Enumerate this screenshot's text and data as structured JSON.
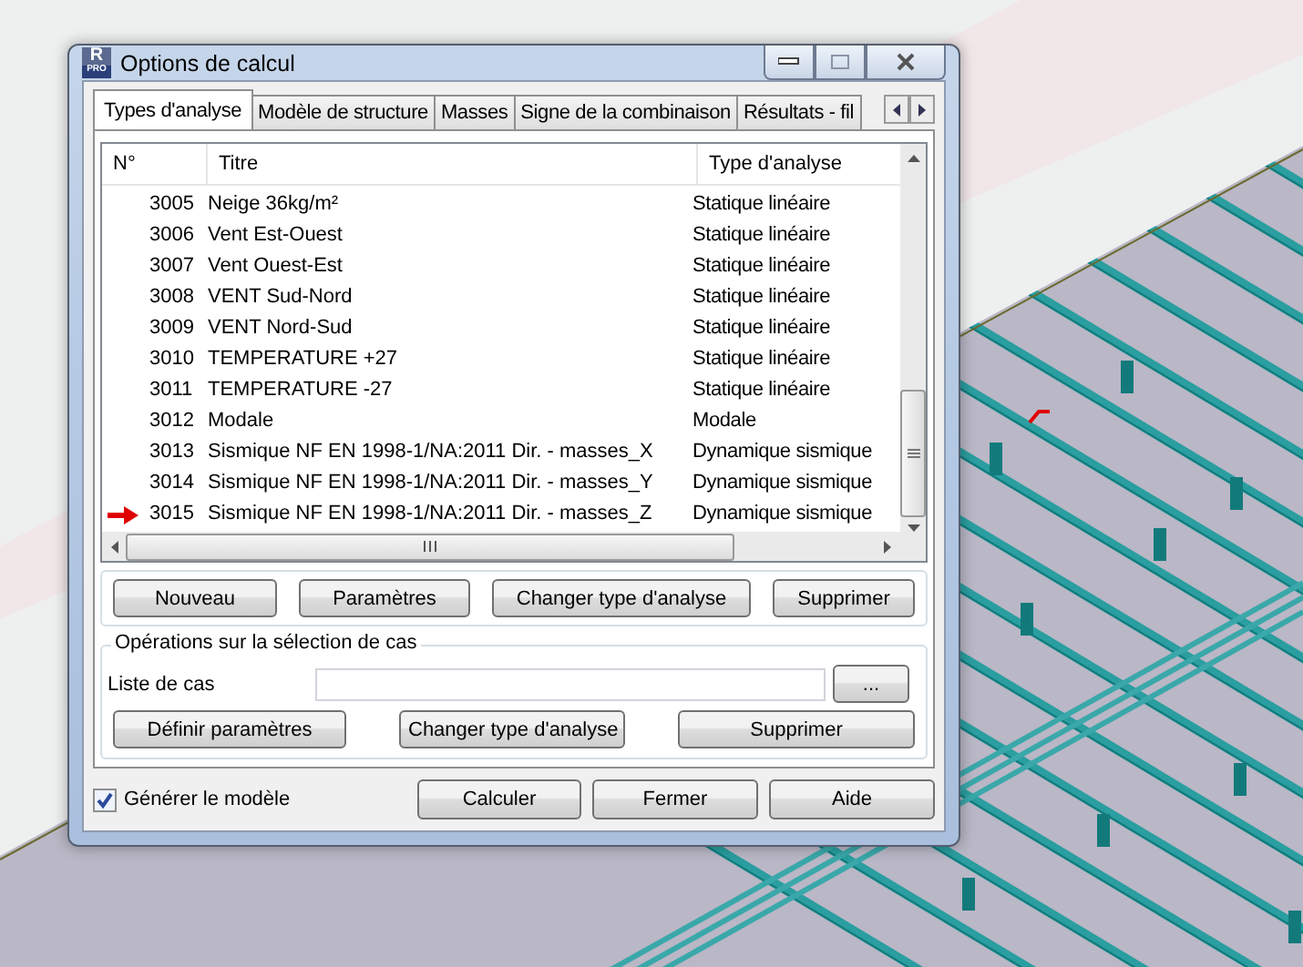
{
  "window": {
    "title": "Options de calcul",
    "logo": {
      "mark": "R",
      "caption": "PRO"
    }
  },
  "tabs": [
    {
      "label": "Types d'analyse",
      "selected": true
    },
    {
      "label": "Modèle de structure",
      "selected": false
    },
    {
      "label": "Masses",
      "selected": false
    },
    {
      "label": "Signe de la combinaison",
      "selected": false
    },
    {
      "label": "Résultats - fil",
      "selected": false
    }
  ],
  "table": {
    "columns": [
      "N°",
      "Titre",
      "Type d'analyse"
    ],
    "rows": [
      {
        "number": "3005",
        "title": "Neige 36kg/m²",
        "type": "Statique linéaire",
        "current": false
      },
      {
        "number": "3006",
        "title": "Vent Est-Ouest",
        "type": "Statique linéaire",
        "current": false
      },
      {
        "number": "3007",
        "title": "Vent Ouest-Est",
        "type": "Statique linéaire",
        "current": false
      },
      {
        "number": "3008",
        "title": "VENT Sud-Nord",
        "type": "Statique linéaire",
        "current": false
      },
      {
        "number": "3009",
        "title": "VENT Nord-Sud",
        "type": "Statique linéaire",
        "current": false
      },
      {
        "number": "3010",
        "title": "TEMPERATURE +27",
        "type": "Statique linéaire",
        "current": false
      },
      {
        "number": "3011",
        "title": "TEMPERATURE -27",
        "type": "Statique linéaire",
        "current": false
      },
      {
        "number": "3012",
        "title": "Modale",
        "type": "Modale",
        "current": false
      },
      {
        "number": "3013",
        "title": "Sismique NF EN 1998-1/NA:2011 Dir. - masses_X",
        "type": "Dynamique sismique",
        "current": false
      },
      {
        "number": "3014",
        "title": "Sismique NF EN 1998-1/NA:2011 Dir. - masses_Y",
        "type": "Dynamique sismique",
        "current": false
      },
      {
        "number": "3015",
        "title": "Sismique NF EN 1998-1/NA:2011 Dir. - masses_Z",
        "type": "Dynamique sismique",
        "current": true
      }
    ]
  },
  "case_buttons": [
    "Nouveau",
    "Paramètres",
    "Changer type d'analyse",
    "Supprimer"
  ],
  "selection_group": {
    "title": "Opérations sur la sélection de cas",
    "list_label": "Liste de cas",
    "browse_button": "...",
    "buttons": [
      "Définir paramètres",
      "Changer type d'analyse",
      "Supprimer"
    ]
  },
  "generate_model": {
    "label": "Générer le modèle",
    "checked": true
  },
  "footer_buttons": [
    "Calculer",
    "Fermer",
    "Aide"
  ]
}
